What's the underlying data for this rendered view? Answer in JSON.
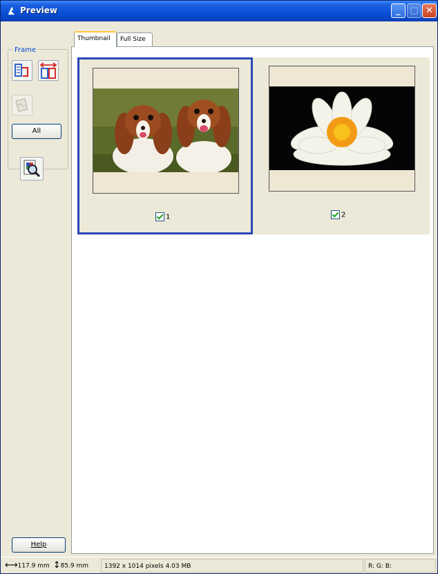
{
  "window": {
    "title": "Preview"
  },
  "left": {
    "frame_label": "Frame",
    "all_label": "All",
    "help_label": "Help"
  },
  "tabs": [
    {
      "label": "Thumbnail"
    },
    {
      "label": "Full Size"
    }
  ],
  "thumbnails": [
    {
      "number": "1",
      "checked": true,
      "selected": true,
      "subject": "two spaniel dogs on grass"
    },
    {
      "number": "2",
      "checked": true,
      "selected": false,
      "subject": "white water lily on black"
    }
  ],
  "status": {
    "width": "117.9 mm",
    "height": "85.9 mm",
    "info": "1392 x 1014 pixels 4.03 MB",
    "rgb": "R: G: B:"
  },
  "colors": {
    "titlebar": "#0a4fd6",
    "selection": "#2a46b8",
    "frame_legend": "#0046d5"
  }
}
